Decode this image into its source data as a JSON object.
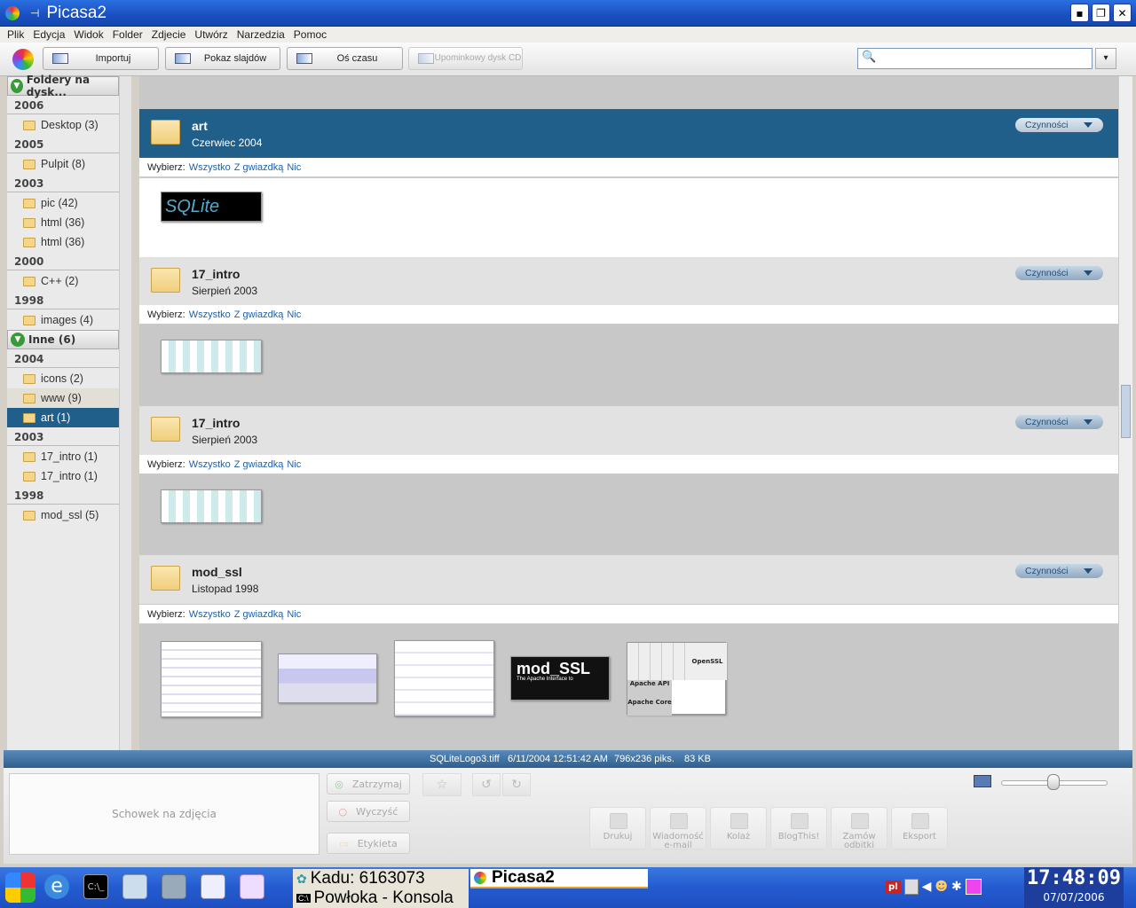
{
  "window": {
    "title": "Picasa2"
  },
  "menu": [
    "Plik",
    "Edycja",
    "Widok",
    "Folder",
    "Zdjecie",
    "Utwórz",
    "Narzedzia",
    "Pomoc"
  ],
  "toolbar": {
    "import_label": "Importuj",
    "slideshow_label": "Pokaz slajdów",
    "timeline_label": "Oś czasu",
    "giftcd_label": "Upominkowy dysk CD"
  },
  "search": {
    "value": "",
    "placeholder": ""
  },
  "sidebar": {
    "group1": {
      "label": "Foldery na dysk..."
    },
    "group2": {
      "label": "Inne (6)"
    },
    "years": [
      "2006",
      "2005",
      "2003",
      "2000",
      "1998",
      "2004",
      "2003",
      "1998"
    ],
    "items": [
      "Desktop (3)",
      "Pulpit (8)",
      "pic (42)",
      "html (36)",
      "html (36)",
      "C++ (2)",
      "images (4)",
      "icons (2)",
      "www (9)",
      "art (1)",
      "17_intro (1)",
      "17_intro (1)",
      "mod_ssl (5)"
    ]
  },
  "folders": [
    {
      "name": "art",
      "date": "Czerwiec 2004",
      "action": "Czynności"
    },
    {
      "name": "17_intro",
      "date": "Sierpień 2003",
      "action": "Czynności"
    },
    {
      "name": "17_intro",
      "date": "Sierpień 2003",
      "action": "Czynności"
    },
    {
      "name": "mod_ssl",
      "date": "Listopad 1998",
      "action": "Czynności"
    }
  ],
  "select_row": {
    "label": "Wybierz:",
    "all": "Wszystko",
    "starred": "Z gwiazdką",
    "none": "Nic"
  },
  "thumbs": {
    "sqlite": "SQLite",
    "modssl": "mod_SSL",
    "modssl_sub": "The Apache Interface to",
    "openssl": "OpenSSL",
    "apache_api": "Apache API",
    "apache_core": "Apache Core"
  },
  "status": {
    "filename": "SQLiteLogo3.tiff",
    "datetime": "6/11/2004 12:51:42 AM",
    "dims": "796x236 piks.",
    "size": "83 KB"
  },
  "tray": {
    "label": "Schowek na zdjęcia",
    "stop": "Zatrzymaj",
    "clear": "Wyczyść",
    "label_btn": "Etykieta"
  },
  "actions": {
    "print": "Drukuj",
    "email": "Wiadomość e-mail",
    "collage": "Kolaż",
    "blog": "BlogThis!",
    "order": "Zamów odbitki",
    "export": "Eksport"
  },
  "taskbar": {
    "task1": "Kadu: 6163073",
    "task2": "Powłoka - Konsola",
    "task3": "Picasa2",
    "lang": "pl",
    "time": "17:48:09",
    "date": "07/07/2006"
  },
  "colors": {
    "accent": "#1f5f8a",
    "title": "#2a6fe0",
    "taskbar": "#245bd0"
  }
}
